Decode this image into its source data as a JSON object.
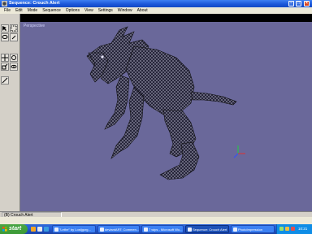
{
  "window": {
    "title": "Sequence: Crouch Alert"
  },
  "menu": [
    "File",
    "Edit",
    "Mode",
    "Sequence",
    "Options",
    "View",
    "Settings",
    "Window",
    "About"
  ],
  "viewport": {
    "label": "Perspective",
    "background": "#6a689a"
  },
  "status": {
    "sequence": "(B) Crouch Alert"
  },
  "taskbar": {
    "start": "start",
    "tasks": [
      {
        "label": "\"Lethe\" by Lostjgcrg...",
        "active": false
      },
      {
        "label": "deviantART: Commen...",
        "active": false
      },
      {
        "label": "7 wips - Microsoft Wo...",
        "active": false
      },
      {
        "label": "Sequence: Crouch Alert",
        "active": true
      },
      {
        "label": "PhotoImpression",
        "active": false
      }
    ],
    "clock": "10:21 PM"
  }
}
